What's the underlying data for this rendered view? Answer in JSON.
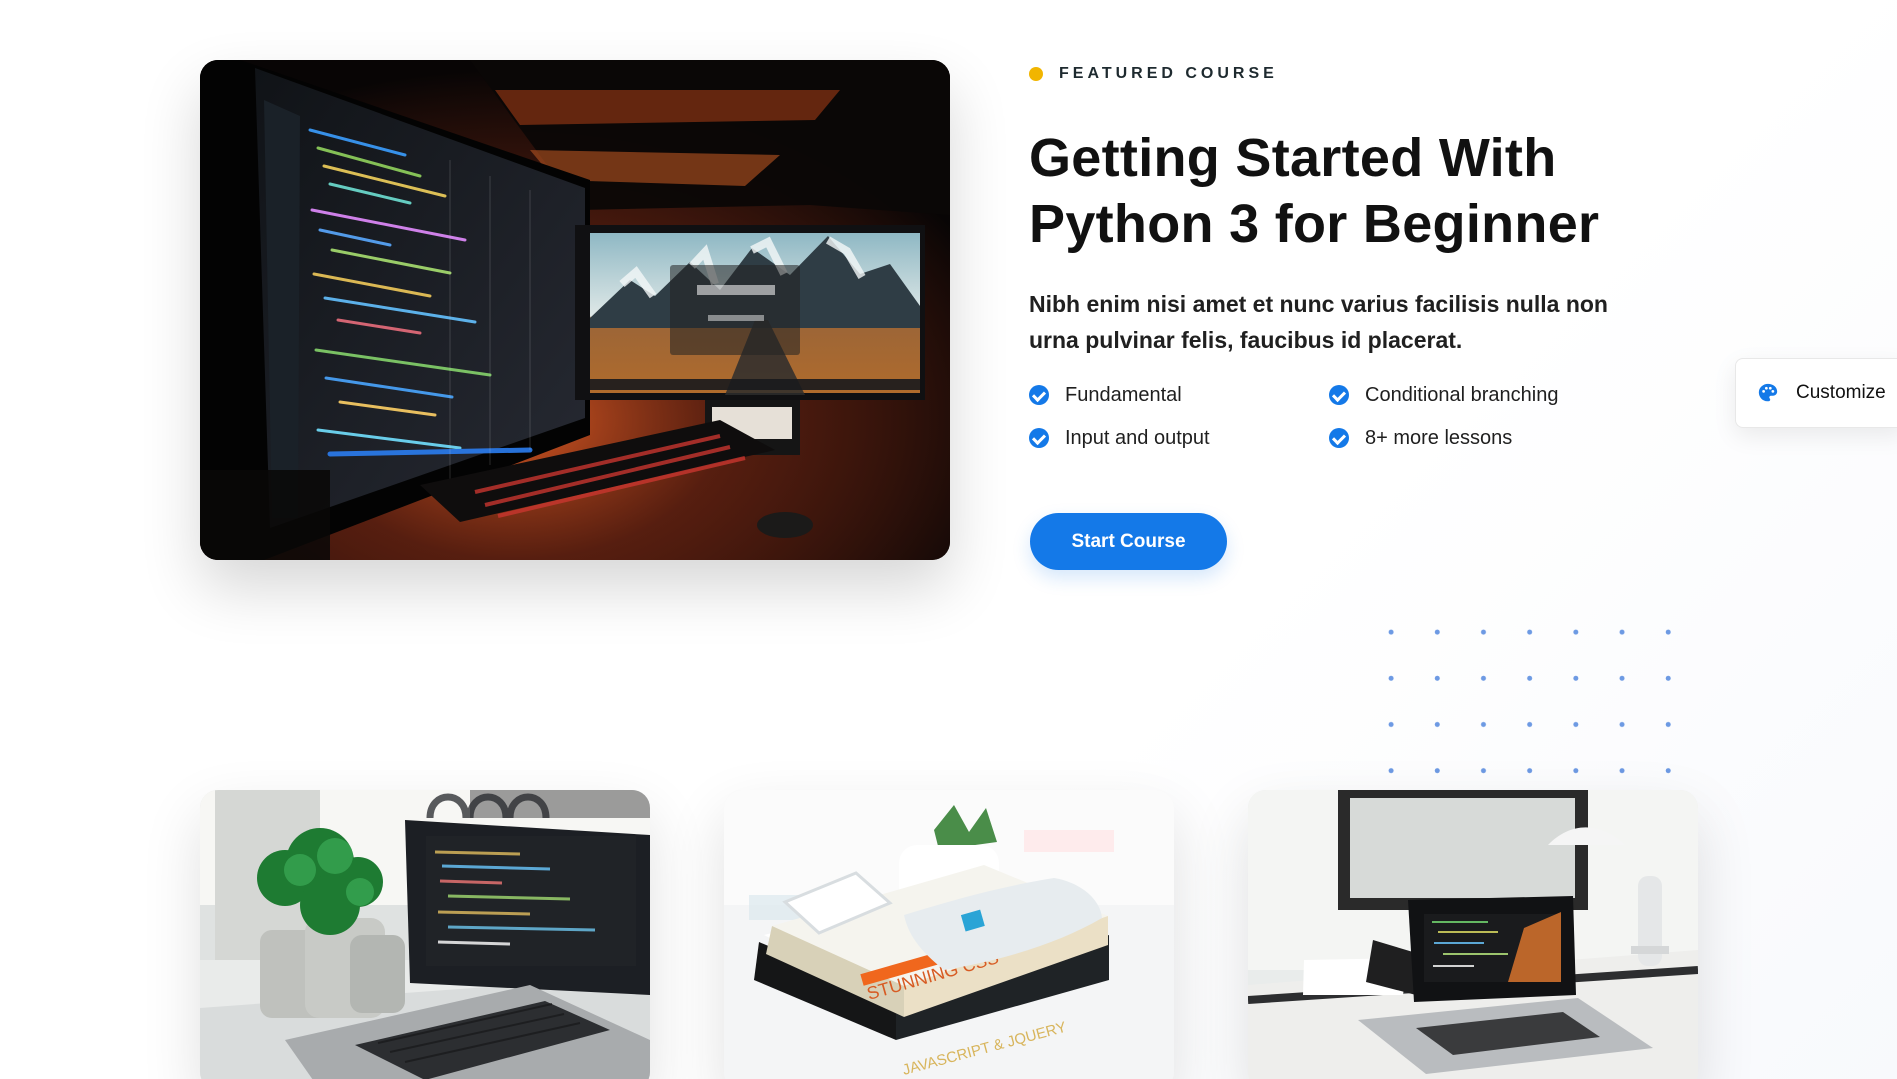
{
  "featured": {
    "eyebrow": "FEATURED COURSE",
    "title": "Getting Started With\nPython 3 for Beginner",
    "description": "Nibh enim nisi amet et nunc varius facilisis nulla non urna pulvinar felis, faucibus id placerat.",
    "features": [
      "Fundamental",
      "Conditional branching",
      "Input and output",
      "8+ more lessons"
    ],
    "button_label": "Start Course"
  },
  "customizer": {
    "label": "Customize",
    "icon": "palette-icon"
  },
  "colors": {
    "accent": "#1479e8",
    "eyebrow_dot": "#f1b500",
    "dot_pattern": "#2f6fd8"
  }
}
